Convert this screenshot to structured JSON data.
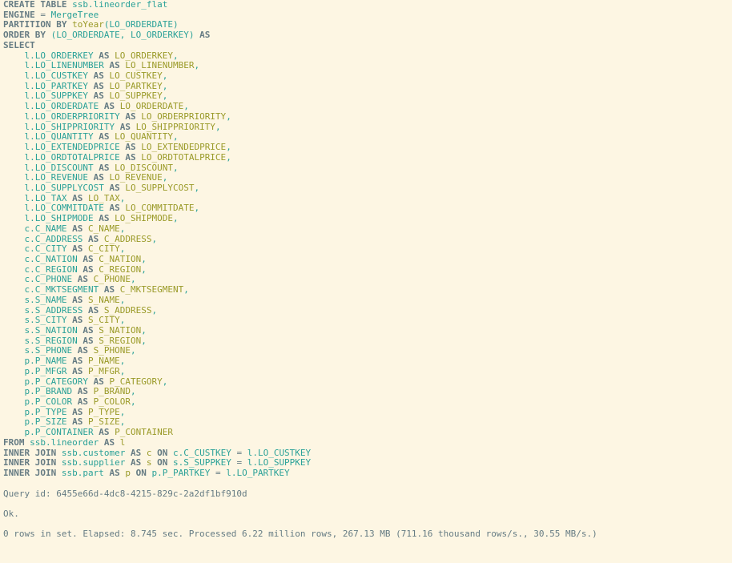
{
  "terminal": {
    "background_color": "#fdf6e3",
    "keyword_color": "#657b83",
    "identifier_color": "#2aa198",
    "alias_color": "#9a9a28",
    "status_color": "#657b83"
  },
  "statement": {
    "header": {
      "create_table_kw": "CREATE TABLE",
      "table_name": "ssb.lineorder_flat",
      "engine_kw": "ENGINE",
      "engine_eq": "=",
      "engine_value": "MergeTree",
      "partition_kw": "PARTITION BY",
      "partition_fn": "toYear",
      "partition_open": "(",
      "partition_arg": "LO_ORDERDATE",
      "partition_close": ")",
      "orderby_kw": "ORDER BY",
      "orderby_open": "(",
      "orderby_col1": "LO_ORDERDATE",
      "orderby_comma": ", ",
      "orderby_col2": "LO_ORDERKEY",
      "orderby_close": ")",
      "orderby_as": "AS",
      "select_kw": "SELECT"
    },
    "as_kw": "AS",
    "comma": ",",
    "columns": [
      {
        "source": "l.LO_ORDERKEY",
        "alias": "LO_ORDERKEY",
        "trailing": ","
      },
      {
        "source": "l.LO_LINENUMBER",
        "alias": "LO_LINENUMBER",
        "trailing": ","
      },
      {
        "source": "l.LO_CUSTKEY",
        "alias": "LO_CUSTKEY",
        "trailing": ","
      },
      {
        "source": "l.LO_PARTKEY",
        "alias": "LO_PARTKEY",
        "trailing": ","
      },
      {
        "source": "l.LO_SUPPKEY",
        "alias": "LO_SUPPKEY",
        "trailing": ","
      },
      {
        "source": "l.LO_ORDERDATE",
        "alias": "LO_ORDERDATE",
        "trailing": ","
      },
      {
        "source": "l.LO_ORDERPRIORITY",
        "alias": "LO_ORDERPRIORITY",
        "trailing": ","
      },
      {
        "source": "l.LO_SHIPPRIORITY",
        "alias": "LO_SHIPPRIORITY",
        "trailing": ","
      },
      {
        "source": "l.LO_QUANTITY",
        "alias": "LO_QUANTITY",
        "trailing": ","
      },
      {
        "source": "l.LO_EXTENDEDPRICE",
        "alias": "LO_EXTENDEDPRICE",
        "trailing": ","
      },
      {
        "source": "l.LO_ORDTOTALPRICE",
        "alias": "LO_ORDTOTALPRICE",
        "trailing": ","
      },
      {
        "source": "l.LO_DISCOUNT",
        "alias": "LO_DISCOUNT",
        "trailing": ","
      },
      {
        "source": "l.LO_REVENUE",
        "alias": "LO_REVENUE",
        "trailing": ","
      },
      {
        "source": "l.LO_SUPPLYCOST",
        "alias": "LO_SUPPLYCOST",
        "trailing": ","
      },
      {
        "source": "l.LO_TAX",
        "alias": "LO_TAX",
        "trailing": ","
      },
      {
        "source": "l.LO_COMMITDATE",
        "alias": "LO_COMMITDATE",
        "trailing": ","
      },
      {
        "source": "l.LO_SHIPMODE",
        "alias": "LO_SHIPMODE",
        "trailing": ","
      },
      {
        "source": "c.C_NAME",
        "alias": "C_NAME",
        "trailing": ","
      },
      {
        "source": "c.C_ADDRESS",
        "alias": "C_ADDRESS",
        "trailing": ","
      },
      {
        "source": "c.C_CITY",
        "alias": "C_CITY",
        "trailing": ","
      },
      {
        "source": "c.C_NATION",
        "alias": "C_NATION",
        "trailing": ","
      },
      {
        "source": "c.C_REGION",
        "alias": "C_REGION",
        "trailing": ","
      },
      {
        "source": "c.C_PHONE",
        "alias": "C_PHONE",
        "trailing": ","
      },
      {
        "source": "c.C_MKTSEGMENT",
        "alias": "C_MKTSEGMENT",
        "trailing": ","
      },
      {
        "source": "s.S_NAME",
        "alias": "S_NAME",
        "trailing": ","
      },
      {
        "source": "s.S_ADDRESS",
        "alias": "S_ADDRESS",
        "trailing": ","
      },
      {
        "source": "s.S_CITY",
        "alias": "S_CITY",
        "trailing": ","
      },
      {
        "source": "s.S_NATION",
        "alias": "S_NATION",
        "trailing": ","
      },
      {
        "source": "s.S_REGION",
        "alias": "S_REGION",
        "trailing": ","
      },
      {
        "source": "s.S_PHONE",
        "alias": "S_PHONE",
        "trailing": ","
      },
      {
        "source": "p.P_NAME",
        "alias": "P_NAME",
        "trailing": ","
      },
      {
        "source": "p.P_MFGR",
        "alias": "P_MFGR",
        "trailing": ","
      },
      {
        "source": "p.P_CATEGORY",
        "alias": "P_CATEGORY",
        "trailing": ","
      },
      {
        "source": "p.P_BRAND",
        "alias": "P_BRAND",
        "trailing": ","
      },
      {
        "source": "p.P_COLOR",
        "alias": "P_COLOR",
        "trailing": ","
      },
      {
        "source": "p.P_TYPE",
        "alias": "P_TYPE",
        "trailing": ","
      },
      {
        "source": "p.P_SIZE",
        "alias": "P_SIZE",
        "trailing": ","
      },
      {
        "source": "p.P_CONTAINER",
        "alias": "P_CONTAINER",
        "trailing": ""
      }
    ],
    "from": {
      "kw": "FROM",
      "table": "ssb.lineorder",
      "as_kw": "AS",
      "alias": "l"
    },
    "joins": [
      {
        "kw": "INNER JOIN",
        "table": "ssb.customer",
        "as_kw": "AS",
        "alias": "c",
        "on_kw": "ON",
        "left": "c.C_CUSTKEY",
        "op": "=",
        "right": "l.LO_CUSTKEY"
      },
      {
        "kw": "INNER JOIN",
        "table": "ssb.supplier",
        "as_kw": "AS",
        "alias": "s",
        "on_kw": "ON",
        "left": "s.S_SUPPKEY",
        "op": "=",
        "right": "l.LO_SUPPKEY"
      },
      {
        "kw": "INNER JOIN",
        "table": "ssb.part",
        "as_kw": "AS",
        "alias": "p",
        "on_kw": "ON",
        "left": "p.P_PARTKEY",
        "op": "=",
        "right": "l.LO_PARTKEY"
      }
    ]
  },
  "result": {
    "query_id_line": "Query id: 6455e66d-4dc8-4215-829c-2a2df1bf910d",
    "status_line": "Ok.",
    "summary_line": "0 rows in set. Elapsed: 8.745 sec. Processed 6.22 million rows, 267.13 MB (711.16 thousand rows/s., 30.55 MB/s.)"
  }
}
